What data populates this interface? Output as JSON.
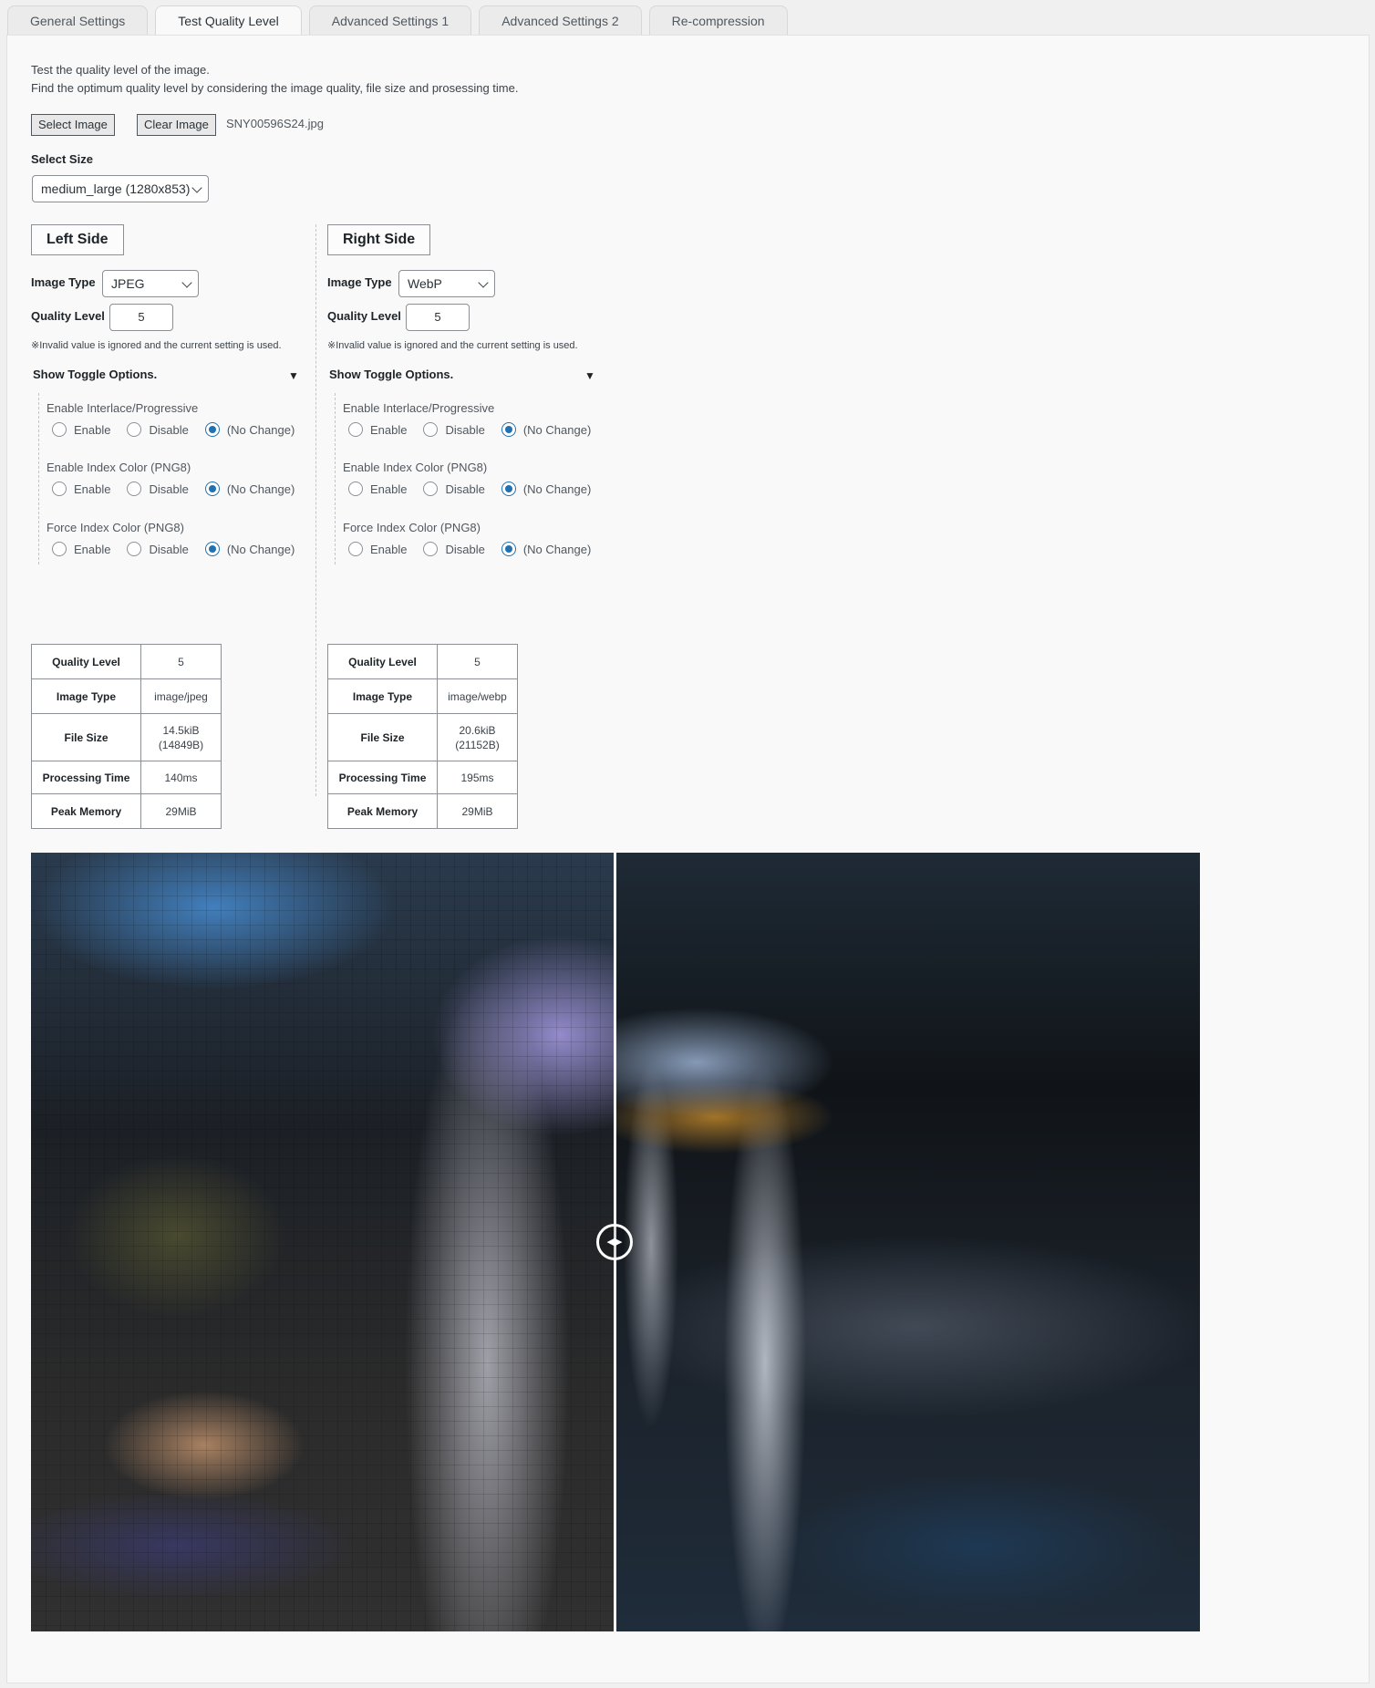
{
  "tabs": [
    {
      "label": "General Settings",
      "active": false
    },
    {
      "label": "Test Quality Level",
      "active": true
    },
    {
      "label": "Advanced Settings 1",
      "active": false
    },
    {
      "label": "Advanced Settings 2",
      "active": false
    },
    {
      "label": "Re-compression",
      "active": false
    }
  ],
  "intro": {
    "line1": "Test the quality level of the image.",
    "line2": "Find the optimum quality level by considering the image quality, file size and prosessing time."
  },
  "buttons": {
    "select_image": "Select Image",
    "clear_image": "Clear Image"
  },
  "selected_file": "SNY00596S24.jpg",
  "size": {
    "label": "Select Size",
    "value": "medium_large (1280x853)"
  },
  "toggle_labels": {
    "enable": "Enable",
    "disable": "Disable",
    "no_change": "(No Change)"
  },
  "left": {
    "title": "Left Side",
    "image_type_label": "Image Type",
    "image_type": "JPEG",
    "quality_label": "Quality Level",
    "quality": "5",
    "note": "※Invalid value is ignored and the current setting is used.",
    "toggle_header": "Show Toggle Options.",
    "toggle_arrow": "▼",
    "groups": [
      {
        "title": "Enable Interlace/Progressive",
        "selected": "no_change"
      },
      {
        "title": "Enable Index Color (PNG8)",
        "selected": "no_change"
      },
      {
        "title": "Force Index Color (PNG8)",
        "selected": "no_change"
      }
    ],
    "results": {
      "quality_level": {
        "key": "Quality Level",
        "value": "5"
      },
      "image_type": {
        "key": "Image Type",
        "value": "image/jpeg"
      },
      "file_size": {
        "key": "File Size",
        "value": "14.5kiB",
        "value2": "(14849B)"
      },
      "processing_time": {
        "key": "Processing Time",
        "value": "140ms"
      },
      "peak_memory": {
        "key": "Peak Memory",
        "value": "29MiB"
      }
    }
  },
  "right": {
    "title": "Right Side",
    "image_type_label": "Image Type",
    "image_type": "WebP",
    "quality_label": "Quality Level",
    "quality": "5",
    "note": "※Invalid value is ignored and the current setting is used.",
    "toggle_header": "Show Toggle Options.",
    "toggle_arrow": "▼",
    "groups": [
      {
        "title": "Enable Interlace/Progressive",
        "selected": "no_change"
      },
      {
        "title": "Enable Index Color (PNG8)",
        "selected": "no_change"
      },
      {
        "title": "Force Index Color (PNG8)",
        "selected": "no_change"
      }
    ],
    "results": {
      "quality_level": {
        "key": "Quality Level",
        "value": "5"
      },
      "image_type": {
        "key": "Image Type",
        "value": "image/webp"
      },
      "file_size": {
        "key": "File Size",
        "value": "20.6kiB",
        "value2": "(21152B)"
      },
      "processing_time": {
        "key": "Processing Time",
        "value": "195ms"
      },
      "peak_memory": {
        "key": "Peak Memory",
        "value": "29MiB"
      }
    }
  },
  "colors": {
    "accent": "#2271b1",
    "panel_bg": "#f9f9f9",
    "page_bg": "#f0f0f1"
  },
  "comparison": {
    "left_label": "left-compressed-image",
    "right_label": "right-compressed-image",
    "handle_icon": "slider-arrows-icon"
  }
}
